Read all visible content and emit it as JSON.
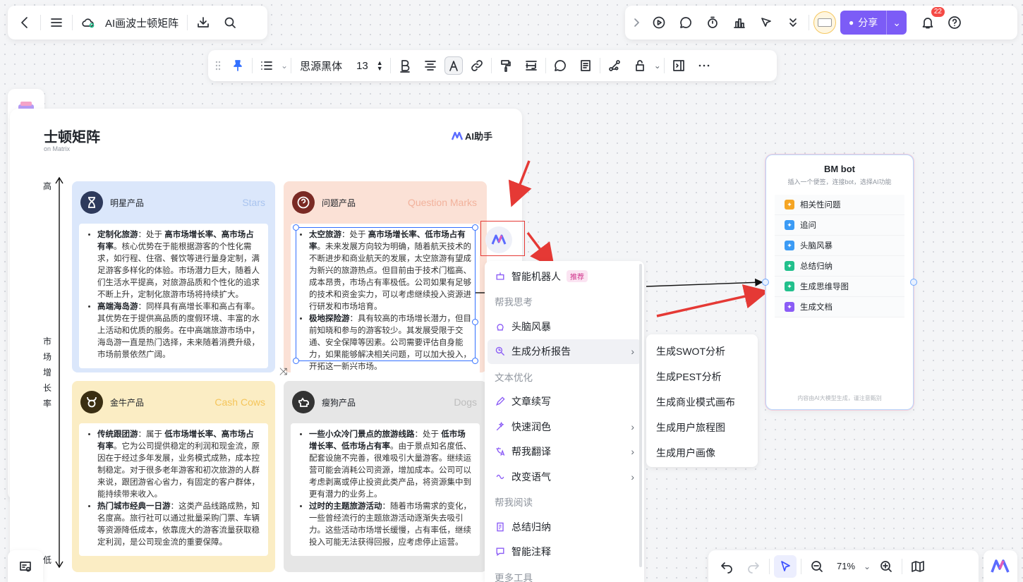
{
  "app": {
    "doc_title": "AI画波士顿矩阵"
  },
  "rightbar": {
    "share_label": "分享",
    "notification_count": "22"
  },
  "fmtbar": {
    "font_name": "思源黑体",
    "font_size": "13"
  },
  "matrix": {
    "title": "士顿矩阵",
    "subtitle": "on Matrix",
    "ai_helper": "AI助手",
    "axis_high": "高",
    "axis_low": "低",
    "axis_label_chars": [
      "市",
      "场",
      "增",
      "长",
      "率"
    ],
    "colors": {
      "stars": "#dbe7fb",
      "question": "#fbe1d6",
      "cash": "#fbedc4",
      "dogs": "#e6e6e6"
    },
    "stars": {
      "name": "明星产品",
      "en": "Stars",
      "items": [
        {
          "head": "定制化旅游",
          "lead": "：处于 ",
          "bold": "高市场增长率、高市场占有率",
          "rest": "。核心优势在于能根据游客的个性化需求，如行程、住宿、餐饮等进行量身定制，满足游客多样化的体验。市场潜力巨大，随着人们生活水平提高，对旅游品质和个性化的追求不断上升，定制化旅游市场将持续扩大。"
        },
        {
          "head": "高端海岛游",
          "lead": "：同样具有高增长率和高占有率。",
          "bold": "",
          "rest": "其优势在于提供高品质的度假环境、丰富的水上活动和优质的服务。在中高端旅游市场中，海岛游一直是热门选择，未来随着消费升级，市场前景依然广阔。"
        }
      ]
    },
    "question": {
      "name": "问题产品",
      "en": "Question Marks",
      "items": [
        {
          "head": "太空旅游",
          "lead": "：处于 ",
          "bold": "高市场增长率、低市场占有率",
          "rest": "。未来发展方向较为明确，随着航天技术的不断进步和商业航天的发展，太空旅游有望成为新兴的旅游热点。但目前由于技术门槛高、成本昂贵，市场占有率极低。公司如果有足够的技术和资金实力，可以考虑继续投入资源进行研发和市场培育。"
        },
        {
          "head": "极地探险游",
          "lead": "：具有较高的市场增长潜力，但目前知晓和参与的游客较少。其发展受限于交通、安全保障等因素。公司需要评估自身能力，如果能够解决相关问题，可以加大投入，开拓这一新兴市场。",
          "bold": "",
          "rest": ""
        }
      ]
    },
    "cash": {
      "name": "金牛产品",
      "en": "Cash Cows",
      "items": [
        {
          "head": "传统跟团游",
          "lead": "：属于 ",
          "bold": "低市场增长率、高市场占有率",
          "rest": "。它为公司提供稳定的利润和现金流，原因在于经过多年发展，业务模式成熟，成本控制稳定。对于很多老年游客和初次旅游的人群来说，跟团游省心省力，有固定的客户群体，能持续带来收入。"
        },
        {
          "head": "热门城市经典一日游",
          "lead": "：这类产品线路成熟，知名度高。旅行社可以通过批量采购门票、车辆等资源降低成本，依靠庞大的游客流量获取稳定利润，是公司现金流的重要保障。",
          "bold": "",
          "rest": ""
        }
      ]
    },
    "dogs": {
      "name": "瘦狗产品",
      "en": "Dogs",
      "items": [
        {
          "head": "一些小众冷门景点的旅游线路",
          "lead": "：处于 ",
          "bold": "低市场增长率、低市场占有率",
          "rest": "。由于景点知名度低、配套设施不完善，很难吸引大量游客。继续运营可能会消耗公司资源，增加成本。公司可以考虑剥离或停止投资此类产品，将资源集中到更有潜力的业务上。"
        },
        {
          "head": "过时的主题旅游活动",
          "lead": "：随着市场需求的变化，一些曾经流行的主题旅游活动逐渐失去吸引力。这些活动市场增长缓慢，占有率低，继续投入可能无法获得回报，应考虑停止运营。",
          "bold": "",
          "rest": ""
        }
      ]
    }
  },
  "menu": {
    "items": [
      {
        "type": "item",
        "label": "智能机器人",
        "badge": "推荐",
        "icon": "robot-icon"
      },
      {
        "type": "header",
        "label": "帮我思考"
      },
      {
        "type": "item",
        "label": "头脑风暴",
        "icon": "brainstorm-icon"
      },
      {
        "type": "item",
        "label": "生成分析报告",
        "icon": "report-icon",
        "chevron": true,
        "active": true
      },
      {
        "type": "header",
        "label": "文本优化"
      },
      {
        "type": "item",
        "label": "文章续写",
        "icon": "pen-icon"
      },
      {
        "type": "item",
        "label": "快速润色",
        "icon": "polish-icon",
        "chevron": true
      },
      {
        "type": "item",
        "label": "帮我翻译",
        "icon": "translate-icon",
        "chevron": true
      },
      {
        "type": "item",
        "label": "改变语气",
        "icon": "tone-icon",
        "chevron": true
      },
      {
        "type": "header",
        "label": "帮我阅读"
      },
      {
        "type": "item",
        "label": "总结归纳",
        "icon": "summary-icon"
      },
      {
        "type": "item",
        "label": "智能注释",
        "icon": "annotate-icon"
      },
      {
        "type": "header",
        "label": "更多工具"
      }
    ]
  },
  "submenu": {
    "items": [
      "生成SWOT分析",
      "生成PEST分析",
      "生成商业模式画布",
      "生成用户旅程图",
      "生成用户画像"
    ]
  },
  "bmbot": {
    "title": "BM bot",
    "subtitle": "插入一个便签，连接bot，选择AI功能",
    "items": [
      {
        "label": "相关性问题",
        "color": "#f5a524"
      },
      {
        "label": "追问",
        "color": "#3b9bf5"
      },
      {
        "label": "头脑风暴",
        "color": "#3b9bf5"
      },
      {
        "label": "总结归纳",
        "color": "#22c08c"
      },
      {
        "label": "生成思维导图",
        "color": "#22c08c"
      },
      {
        "label": "生成文档",
        "color": "#8b5cf6"
      }
    ],
    "footer": "内容由AI大模型生成，谨注意甄别"
  },
  "bottom": {
    "zoom": "71%"
  }
}
